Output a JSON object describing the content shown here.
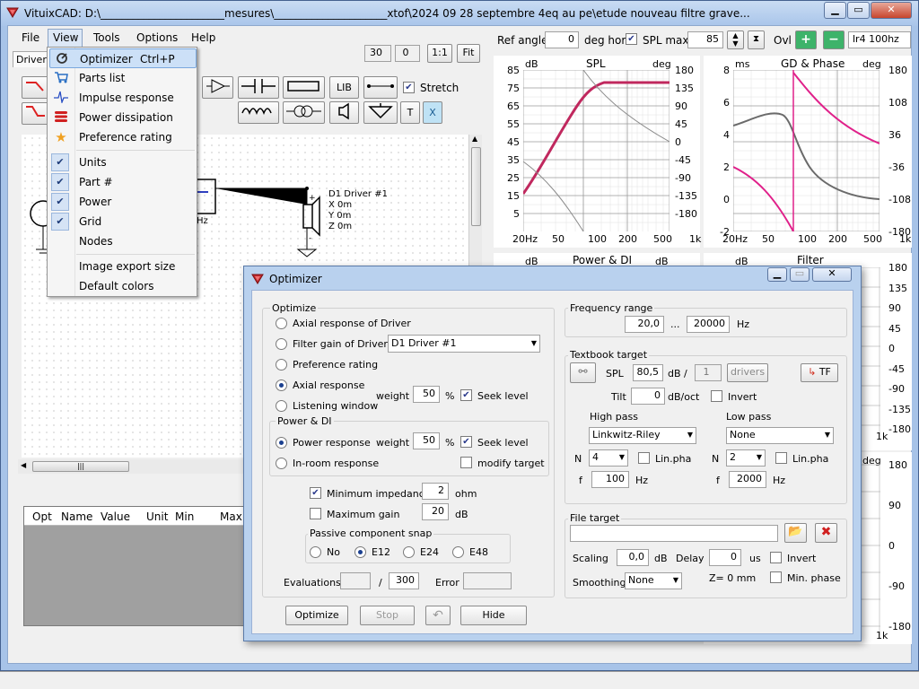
{
  "app": {
    "title": "VituixCAD: D:\\_______________________mesures\\_____________________xtof\\2024 09 28 septembre 4eq au pe\\etude nouveau filtre grave..."
  },
  "menubar": [
    "File",
    "View",
    "Tools",
    "Options",
    "Help"
  ],
  "toolbar": {
    "zoom_value": "30",
    "offset_value": "0",
    "one_to_one": "1:1",
    "fit": "Fit",
    "lib": "LIB",
    "stretch": "Stretch",
    "t_btn": "T",
    "x_btn": "X"
  },
  "left_tab": "Drivers",
  "view_menu": {
    "items": [
      {
        "label": "Optimizer",
        "shortcut": "Ctrl+P",
        "icon": "optimizer-icon"
      },
      {
        "label": "Parts list",
        "icon": "parts-list-icon"
      },
      {
        "label": "Impulse response",
        "icon": "impulse-icon"
      },
      {
        "label": "Power dissipation",
        "icon": "power-dissipation-icon"
      },
      {
        "label": "Preference rating",
        "icon": "star-icon"
      },
      {
        "label": "Units",
        "checked": true
      },
      {
        "label": "Part #",
        "checked": true
      },
      {
        "label": "Power",
        "checked": true
      },
      {
        "label": "Grid",
        "checked": true
      },
      {
        "label": "Nodes",
        "checked": false
      },
      {
        "label": "Image export size"
      },
      {
        "label": "Default colors"
      }
    ]
  },
  "schematic": {
    "driver_label": "D1 Driver #1",
    "x": "X 0m",
    "y": "Y 0m",
    "z": "Z 0m",
    "hz_fragment": "Hz"
  },
  "parts_table": {
    "headers": [
      "Opt",
      "Name",
      "Value",
      "Unit",
      "Min",
      "Max"
    ]
  },
  "right_header": {
    "ref_angle_label": "Ref angle",
    "ref_angle_value": "0",
    "deg_hor": "deg hor",
    "spl_max_label": "SPL max",
    "spl_max_value": "85",
    "ovl": "Ovl",
    "filter_preset": "lr4 100hz"
  },
  "spl_graph": {
    "title": "SPL",
    "left_unit": "dB",
    "right_unit": "deg",
    "left_ticks": [
      "85",
      "75",
      "65",
      "55",
      "45",
      "35",
      "25",
      "15",
      "5"
    ],
    "right_ticks": [
      "180",
      "135",
      "90",
      "45",
      "0",
      "-45",
      "-90",
      "-135",
      "-180"
    ],
    "x_ticks": [
      "20Hz",
      "50",
      "100",
      "200",
      "500",
      "1k"
    ]
  },
  "gd_graph": {
    "title": "GD & Phase",
    "left_unit": "ms",
    "right_unit": "deg",
    "left_ticks": [
      "8",
      "6",
      "4",
      "2",
      "0",
      "-2"
    ],
    "right_ticks": [
      "180",
      "108",
      "36",
      "-36",
      "-108",
      "-180"
    ],
    "x_ticks": [
      "20Hz",
      "50",
      "100",
      "200",
      "500",
      "1k"
    ]
  },
  "power_graph": {
    "title": "Power & DI",
    "left_unit": "dB",
    "right_unit": "dB"
  },
  "filter_graph": {
    "title": "Filter",
    "left_unit": "dB",
    "right_ticks": [
      "180",
      "135",
      "90",
      "45",
      "0",
      "-45",
      "-90",
      "-135",
      "-180"
    ],
    "x_tick": "1k"
  },
  "bottom_graph": {
    "unit": "deg",
    "right_ticks": [
      "180",
      "90",
      "0",
      "-90",
      "-180"
    ],
    "x_tick": "1k"
  },
  "optimizer": {
    "title": "Optimizer",
    "optimize_group": "Optimize",
    "options": [
      "Axial response of Driver",
      "Filter gain of Driver",
      "Preference rating",
      "Axial response",
      "Listening window"
    ],
    "driver_select": "D1 Driver #1",
    "weight_label": "weight",
    "weight_value": "50",
    "percent": "%",
    "seek_level": "Seek level",
    "power_group": "Power & DI",
    "power_options": [
      "Power response",
      "In-room response"
    ],
    "power_weight": "50",
    "modify_target": "modify target",
    "min_impedance": "Minimum impedance",
    "min_impedance_value": "2",
    "ohm": "ohm",
    "max_gain": "Maximum gain",
    "max_gain_value": "20",
    "db": "dB",
    "snap_group": "Passive component snap",
    "snap_options": [
      "No",
      "E12",
      "E24",
      "E48"
    ],
    "evaluations_label": "Evaluations",
    "evaluations_value": "",
    "slash": "/",
    "evaluations_max": "300",
    "error_label": "Error",
    "error_value": "",
    "buttons": {
      "optimize": "Optimize",
      "stop": "Stop",
      "undo": "↶",
      "hide": "Hide"
    },
    "freq_group": "Frequency range",
    "freq_min": "20,0",
    "ellipsis": "...",
    "freq_max": "20000",
    "hz": "Hz",
    "textbook_group": "Textbook target",
    "spl_label": "SPL",
    "spl_value": "80,5",
    "db_per": "dB /",
    "drivers_count": "1",
    "drivers_btn": "drivers",
    "tf_btn": "TF",
    "tilt_label": "Tilt",
    "tilt_value": "0",
    "tilt_unit": "dB/oct",
    "invert": "Invert",
    "high_pass": "High pass",
    "high_pass_type": "Linkwitz-Riley",
    "low_pass": "Low pass",
    "low_pass_type": "None",
    "n_label": "N",
    "hp_order": "4",
    "lp_order": "2",
    "lin_pha": "Lin.pha",
    "f_label": "f",
    "hp_freq": "100",
    "lp_freq": "2000",
    "file_group": "File target",
    "file_path": "",
    "scaling_label": "Scaling",
    "scaling_value": "0,0",
    "delay_label": "Delay",
    "delay_value": "0",
    "us": "us",
    "smoothing_label": "Smoothing",
    "smoothing_value": "None",
    "z_label": "Z= 0 mm",
    "min_phase": "Min. phase"
  },
  "colors": {
    "accent": "#c8336a",
    "menu_highlight": "#cce0f7",
    "window_frame": "#a7c3e8"
  }
}
